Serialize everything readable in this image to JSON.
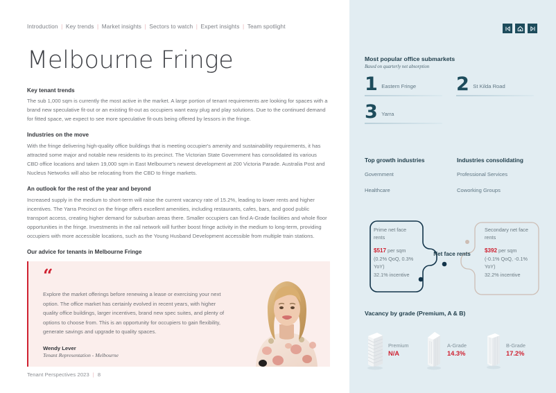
{
  "breadcrumb": {
    "items": [
      "Introduction",
      "Key trends",
      "Market insights",
      "Sectors to watch",
      "Expert insights",
      "Team spotlight"
    ],
    "separator": "|"
  },
  "nav": {
    "prev_label": "first-page",
    "home_label": "home",
    "next_label": "last-page"
  },
  "title": "Melbourne Fringe",
  "sections": [
    {
      "heading": "Key tenant trends",
      "body": "The sub 1,000 sqm is currently the most active in the market. A large portion of tenant requirements are looking for spaces with a brand new speculative fit-out or an existing fit-out as occupiers want easy plug and play solutions. Due to the continued demand for fitted space, we expect to see more speculative fit-outs being offered by lessors in the fringe."
    },
    {
      "heading": "Industries on the move",
      "body": "With the fringe delivering high-quality office buildings that is meeting occupier's amenity and sustainability requirements, it has attracted some major and notable new residents to its precinct. The Victorian State Government has consolidated its various CBD office locations and taken 19,000 sqm in East Melbourne's newest development at 200 Victoria Parade. Australia Post and Nucleus Networks will also be relocating from the CBD to fringe markets."
    },
    {
      "heading": "An outlook for the rest of the year and beyond",
      "body": "Increased supply in the medium to short-term will raise the current vacancy rate of 15.2%, leading to lower rents and higher incentives. The Yarra Precinct on the fringe offers excellent amenities, including restaurants, cafes, bars, and good public transport access, creating higher demand for suburban areas there. Smaller occupiers can find A-Grade facilities and whole floor opportunities in the fringe. Investments in the rail network will further boost fringe activity in the medium to long-term, providing occupiers with more accessible locations, such as the Young Husband Development accessible from multiple train stations."
    }
  ],
  "advice": {
    "heading": "Our advice for tenants in Melbourne Fringe",
    "quote_mark": "“",
    "quote": "Explore the market offerings before renewing a lease or exercising your next option. The office market has certainly evolved in recent years, with higher quality office buildings, larger incentives, brand new spec suites, and plenty of options to choose from. This is an opportunity for occupiers to gain flexibility, generate savings and upgrade to quality spaces.",
    "name": "Wendy Lever",
    "role": "Tenant Representation - Melbourne"
  },
  "footer": {
    "publication": "Tenant Perspectives 2023",
    "separator": "|",
    "page_number": "8"
  },
  "submarkets": {
    "title": "Most popular office submarkets",
    "subtitle": "Based on quarterly net absorption",
    "items": [
      {
        "rank": "1",
        "name": "Eastern Fringe"
      },
      {
        "rank": "2",
        "name": "St Kilda Road"
      },
      {
        "rank": "3",
        "name": "Yarra"
      }
    ]
  },
  "industries": {
    "growth": {
      "heading": "Top growth industries",
      "items": [
        "Government",
        "Healthcare"
      ]
    },
    "consolidating": {
      "heading": "Industries consolidating",
      "items": [
        "Professional Services",
        "Coworking Groups"
      ]
    }
  },
  "rents": {
    "center_label": "Net face rents",
    "prime": {
      "title": "Prime net face rents",
      "price": "$517",
      "unit": " per sqm",
      "change": "(0.2% QoQ, 0.3% YoY)",
      "incentive": "32.1% incentive"
    },
    "secondary": {
      "title": "Secondary net face rents",
      "price": "$392",
      "unit": " per sqm",
      "change": "(-0.1% QoQ, -0.1% YoY)",
      "incentive": "32.2% incentive"
    }
  },
  "vacancy": {
    "title": "Vacancy by grade (Premium, A & B)",
    "items": [
      {
        "label": "Premium",
        "value": "N/A"
      },
      {
        "label": "A-Grade",
        "value": "14.3%"
      },
      {
        "label": "B-Grade",
        "value": "17.2%"
      }
    ]
  },
  "colors": {
    "accent_red": "#cf2030",
    "panel_bg": "#e2edf2",
    "dark_teal": "#1d4c5c",
    "quote_bg": "#fbeeec"
  }
}
